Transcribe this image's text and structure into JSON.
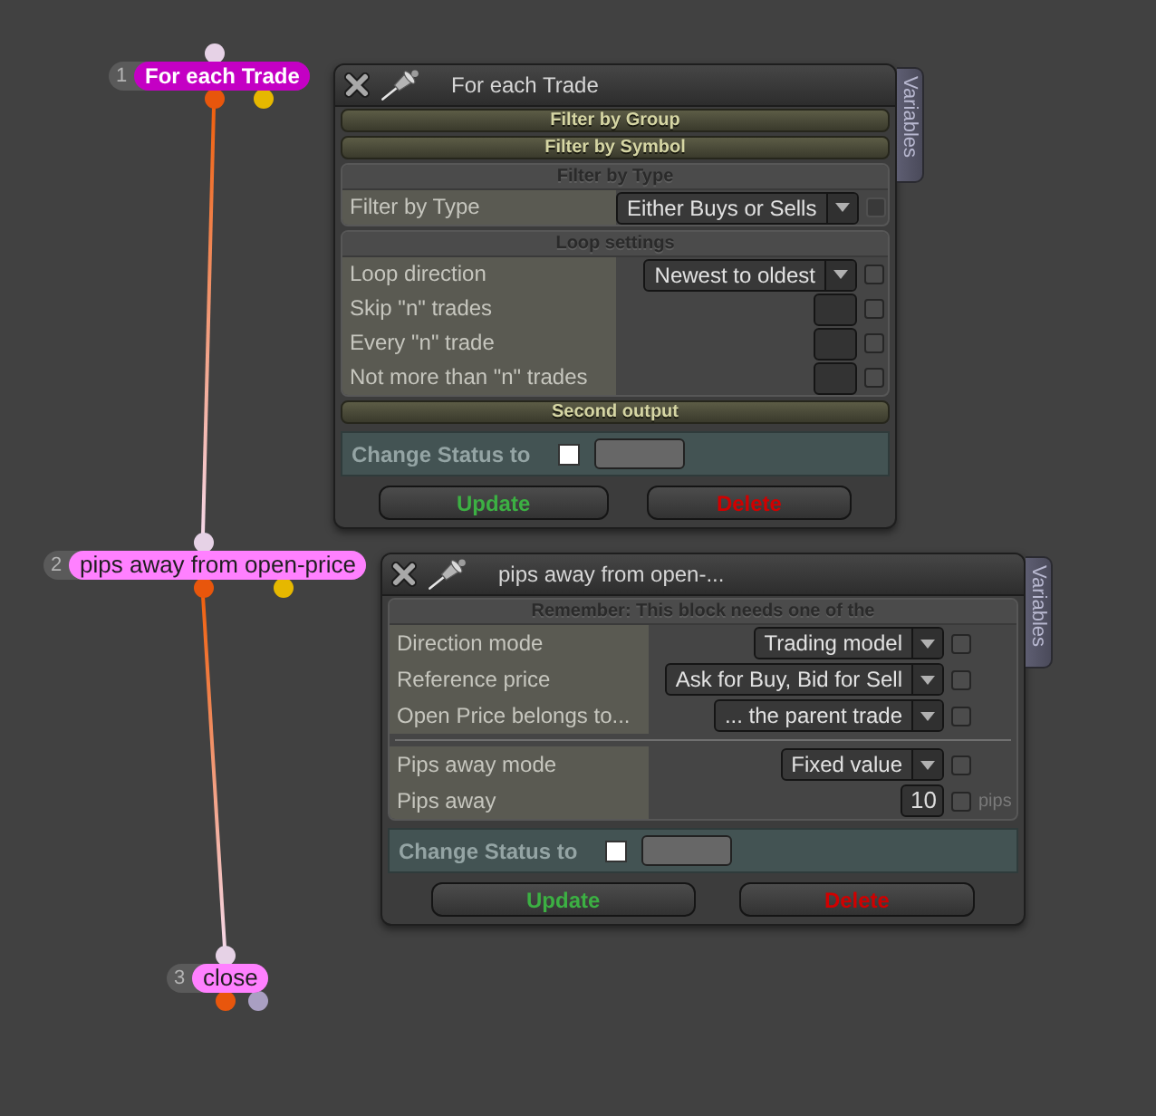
{
  "canvas": {
    "nodes": [
      {
        "number": "1",
        "label": "For each Trade",
        "selected": true,
        "outputs": [
          {
            "color": "#e8560c"
          },
          {
            "color": "#e6b800"
          }
        ]
      },
      {
        "number": "2",
        "label": "pips away from open-price",
        "selected": false,
        "outputs": [
          {
            "color": "#e8560c"
          },
          {
            "color": "#e6b800"
          }
        ]
      },
      {
        "number": "3",
        "label": "close",
        "selected": false,
        "outputs": [
          {
            "color": "#e8560c"
          },
          {
            "color": "#a99fc2"
          }
        ]
      }
    ]
  },
  "panels": [
    {
      "title": "For each Trade",
      "side_tab": "Variables",
      "sections": [
        {
          "label": "Filter by Group",
          "expanded": false
        },
        {
          "label": "Filter by Symbol",
          "expanded": false
        },
        {
          "label": "Filter by Type",
          "expanded": true,
          "rows": [
            {
              "kind": "dropdown",
              "label": "Filter by Type",
              "value": "Either Buys or Sells",
              "checkbox": {
                "checked": false,
                "disabled": true
              }
            }
          ]
        },
        {
          "label": "Loop settings",
          "expanded": true,
          "rows": [
            {
              "kind": "dropdown",
              "label": "Loop direction",
              "value": "Newest to oldest",
              "checkbox": {
                "checked": false,
                "disabled": false
              }
            },
            {
              "kind": "number",
              "label": "Skip \"n\" trades",
              "checkbox": {
                "checked": false,
                "disabled": false
              }
            },
            {
              "kind": "number",
              "label": "Every \"n\" trade",
              "checkbox": {
                "checked": false,
                "disabled": false
              }
            },
            {
              "kind": "number",
              "label": "Not more than \"n\" trades",
              "checkbox": {
                "checked": false,
                "disabled": false
              }
            }
          ]
        },
        {
          "label": "Second output",
          "expanded": false
        }
      ],
      "status": {
        "label": "Change Status to",
        "checked": false
      },
      "buttons": [
        {
          "label": "Update",
          "kind": "update"
        },
        {
          "label": "Delete",
          "kind": "delete"
        }
      ]
    },
    {
      "title": "pips away from open-...",
      "side_tab": "Variables",
      "sections": [
        {
          "label": "Remember: This block needs one of the",
          "expanded": true,
          "rows": [
            {
              "kind": "dropdown",
              "label": "Direction mode",
              "value": "Trading model",
              "checkbox": {
                "checked": false,
                "disabled": false
              }
            },
            {
              "kind": "dropdown",
              "label": "Reference price",
              "value": "Ask for Buy, Bid for Sell",
              "checkbox": {
                "checked": false,
                "disabled": false
              }
            },
            {
              "kind": "dropdown",
              "label": "Open Price belongs to...",
              "value": "... the parent trade",
              "checkbox": {
                "checked": false,
                "disabled": false
              }
            },
            {
              "kind": "separator"
            },
            {
              "kind": "dropdown",
              "label": "Pips away mode",
              "value": "Fixed value",
              "checkbox": {
                "checked": false,
                "disabled": false
              }
            },
            {
              "kind": "number",
              "label": "Pips away",
              "value": "10",
              "unit": "pips",
              "checkbox": {
                "checked": false,
                "disabled": false
              }
            }
          ]
        }
      ],
      "status": {
        "label": "Change Status to",
        "checked": false
      },
      "buttons": [
        {
          "label": "Update",
          "kind": "update"
        },
        {
          "label": "Delete",
          "kind": "delete"
        }
      ]
    }
  ]
}
